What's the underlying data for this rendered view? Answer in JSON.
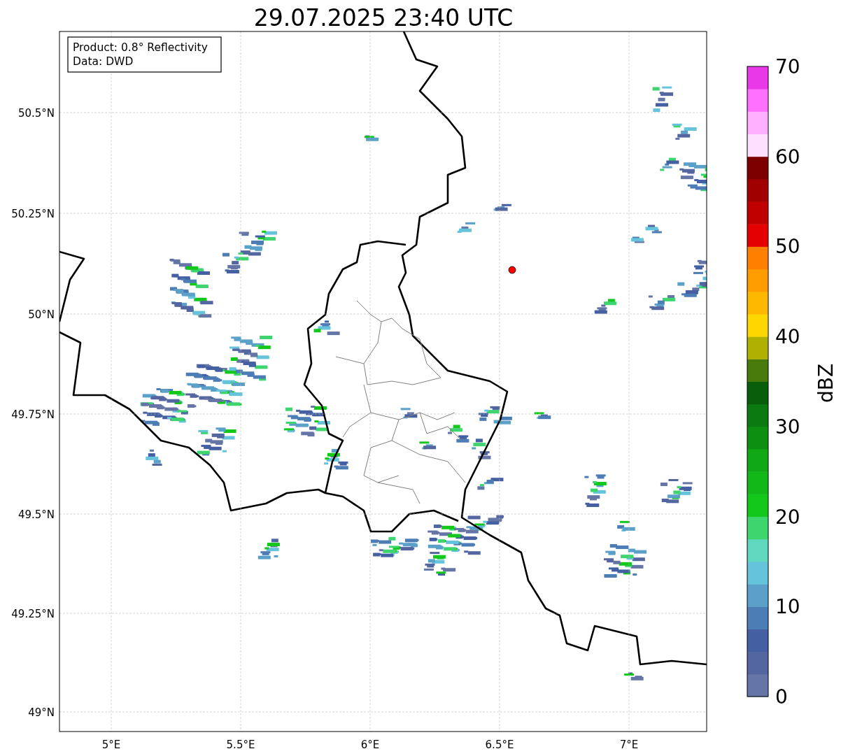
{
  "title": "29.07.2025 23:40 UTC",
  "info_box": [
    "Product: 0.8° Reflectivity",
    "Data: DWD"
  ],
  "x_ticks": [
    "5°E",
    "5.5°E",
    "6°E",
    "6.5°E",
    "7°E"
  ],
  "y_ticks": [
    "50.5°N",
    "50.25°N",
    "50°N",
    "49.75°N",
    "49.5°N",
    "49.25°N",
    "49°N"
  ],
  "colorbar": {
    "label": "dBZ",
    "ticks": [
      "70",
      "60",
      "50",
      "40",
      "30",
      "20",
      "10",
      "0"
    ],
    "segments": [
      {
        "color": "#6575a6"
      },
      {
        "color": "#5366a0"
      },
      {
        "color": "#4560a2"
      },
      {
        "color": "#4d7db5"
      },
      {
        "color": "#5aa0c8"
      },
      {
        "color": "#66c3dc"
      },
      {
        "color": "#60d8c0"
      },
      {
        "color": "#3ed46e"
      },
      {
        "color": "#13c81a"
      },
      {
        "color": "#12b818"
      },
      {
        "color": "#10a814"
      },
      {
        "color": "#0d8f12"
      },
      {
        "color": "#0b7a10"
      },
      {
        "color": "#085e0b"
      },
      {
        "color": "#487a0c"
      },
      {
        "color": "#b0b000"
      },
      {
        "color": "#ffd700"
      },
      {
        "color": "#ffb800"
      },
      {
        "color": "#ff9c00"
      },
      {
        "color": "#ff7f00"
      },
      {
        "color": "#e40000"
      },
      {
        "color": "#c00000"
      },
      {
        "color": "#a00000"
      },
      {
        "color": "#7c0000"
      },
      {
        "color": "#ffdfff"
      },
      {
        "color": "#ffb0ff"
      },
      {
        "color": "#ff70ff"
      },
      {
        "color": "#e838e8"
      }
    ]
  }
}
